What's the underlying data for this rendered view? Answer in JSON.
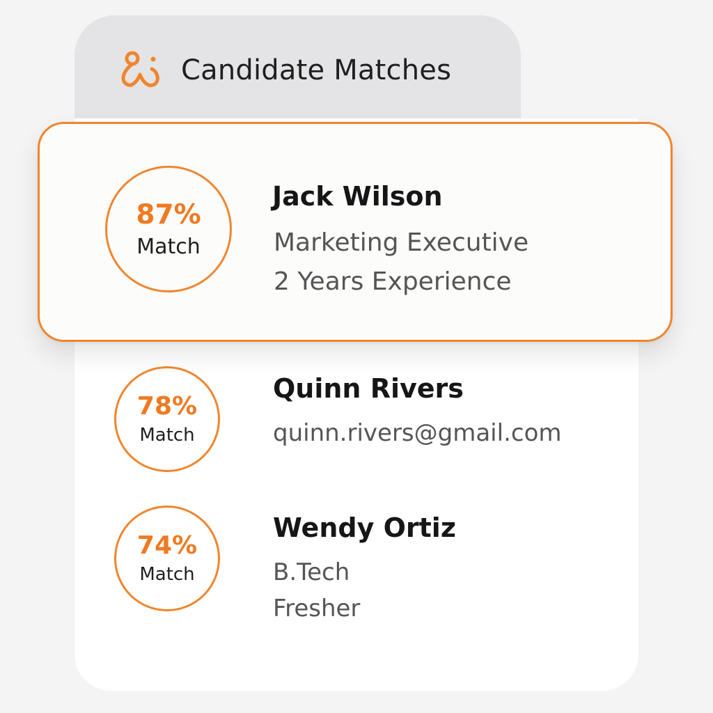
{
  "header": {
    "title": "Candidate Matches",
    "logo_icon": "connect-people-icon"
  },
  "colors": {
    "accent": "#f0852d",
    "background": "#f4f4f5",
    "header_tab": "#e4e4e6",
    "panel": "#ffffff"
  },
  "candidates": [
    {
      "match_percent": "87%",
      "match_label": "Match",
      "name": "Jack Wilson",
      "details": [
        "Marketing Executive",
        "2 Years Experience"
      ],
      "selected": true
    },
    {
      "match_percent": "78%",
      "match_label": "Match",
      "name": "Quinn Rivers",
      "details": [
        "quinn.rivers@gmail.com"
      ],
      "selected": false
    },
    {
      "match_percent": "74%",
      "match_label": "Match",
      "name": "Wendy Ortiz",
      "details": [
        "B.Tech",
        "Fresher"
      ],
      "selected": false
    }
  ]
}
